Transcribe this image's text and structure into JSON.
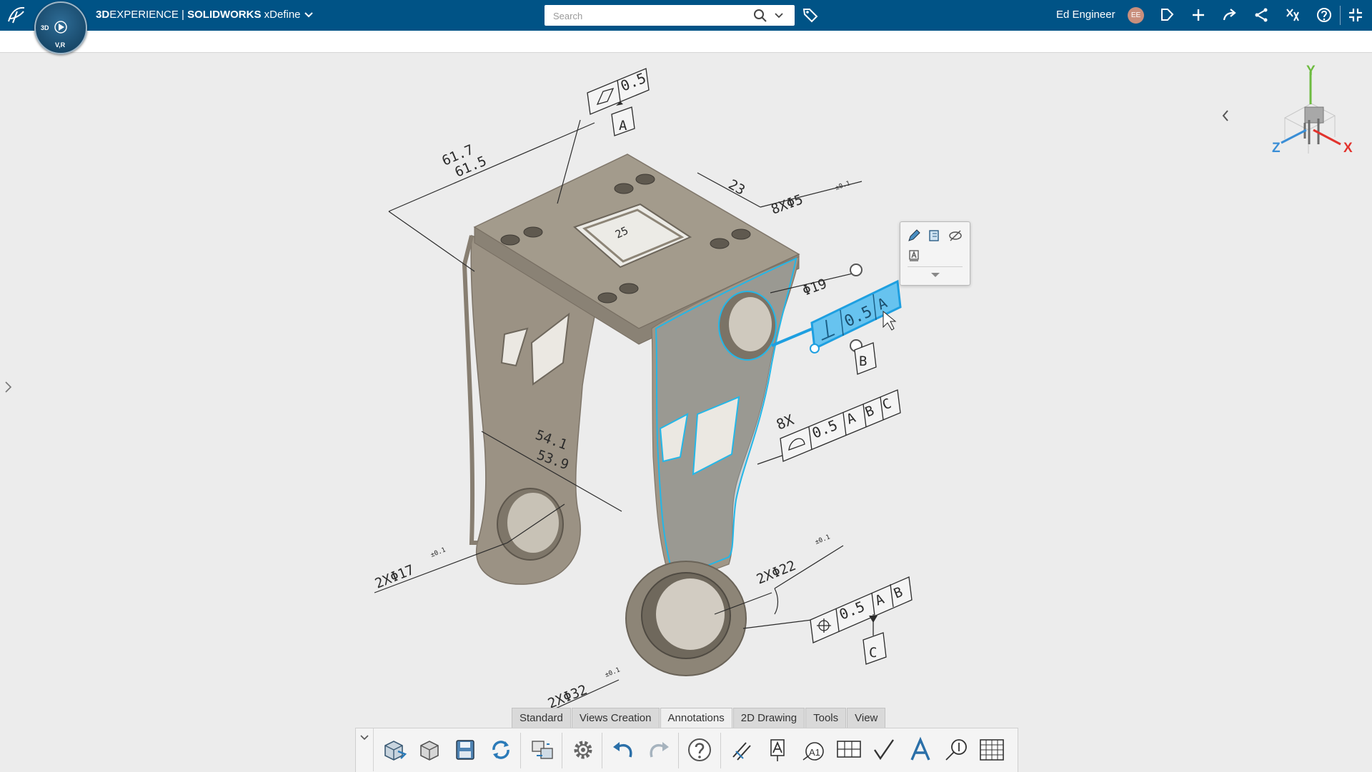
{
  "app": {
    "brand_bold": "3D",
    "brand_main": "EXPERIENCE | ",
    "brand_product": "SOLIDWORKS",
    "brand_app": "xDefine",
    "compass_labels": [
      "3D",
      "V,R"
    ]
  },
  "search": {
    "placeholder": "Search"
  },
  "user": {
    "name": "Ed Engineer",
    "initials": "EE"
  },
  "tabs": [
    {
      "label": "Standard"
    },
    {
      "label": "Views Creation"
    },
    {
      "label": "Annotations",
      "active": true
    },
    {
      "label": "2D Drawing"
    },
    {
      "label": "Tools"
    },
    {
      "label": "View"
    }
  ],
  "triad": {
    "x": "X",
    "y": "Y",
    "z": "Z"
  },
  "annotations": {
    "dim_top_upper": "61.7",
    "dim_top_lower": "61.5",
    "dim_23": "23",
    "dim_holes": "8XΦ5",
    "tol_01": "±0.1",
    "dim_phi19": "Φ19",
    "dim_25": "25",
    "dim_mid_upper": "54.1",
    "dim_mid_lower": "53.9",
    "dim_phi17": "2XΦ17",
    "dim_phi22": "2XΦ22",
    "dim_phi32": "2XΦ32",
    "fcf_top_value": "0.5",
    "datum_a": "A",
    "fcf_sel_value": "0.5",
    "fcf_sel_datum": "A",
    "datum_b": "B",
    "fcf_profile_count": "8X",
    "fcf_profile_value": "0.5",
    "fcf_profile_d1": "A",
    "fcf_profile_d2": "B",
    "fcf_profile_d3": "C",
    "fcf_pos_value": "0.5",
    "fcf_pos_d1": "A",
    "fcf_pos_d2": "B",
    "datum_c": "C"
  },
  "colors": {
    "topbar": "#005386",
    "selection": "#1e9fe0",
    "part": "#a29a8c"
  }
}
